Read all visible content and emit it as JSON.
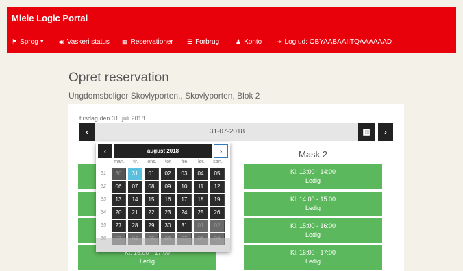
{
  "app": {
    "brand": "Miele Logic Portal"
  },
  "nav": {
    "items": [
      {
        "id": "sprog",
        "icon": "flag-icon",
        "label": "Sprog"
      },
      {
        "id": "vaskeri",
        "icon": "eye-icon",
        "label": "Vaskeri status"
      },
      {
        "id": "reservationer",
        "icon": "calendar-icon",
        "label": "Reservationer"
      },
      {
        "id": "forbrug",
        "icon": "list-icon",
        "label": "Forbrug"
      },
      {
        "id": "konto",
        "icon": "user-icon",
        "label": "Konto"
      },
      {
        "id": "logud",
        "icon": "logout-icon",
        "label": "Log ud: OBYAABAAIITQAAAAAAD"
      }
    ]
  },
  "page": {
    "title": "Opret reservation",
    "subtitle": "Ungdomsboliger Skovlyporten., Skovlyporten, Blok 2"
  },
  "date_selector": {
    "label": "tirsdag den 31. juli 2018",
    "value": "31-07-2018"
  },
  "machines": [
    {
      "name": "Mask 2"
    }
  ],
  "slots_left_partial": [
    "Kl. 16:00 - 17:00",
    "Ledig"
  ],
  "slots_mask2": [
    {
      "time": "Kl. 13:00 - 14:00",
      "status": "Ledig"
    },
    {
      "time": "Kl. 14:00 - 15:00",
      "status": "Ledig"
    },
    {
      "time": "Kl. 15:00 - 16:00",
      "status": "Ledig"
    },
    {
      "time": "Kl. 16:00 - 17:00",
      "status": "Ledig"
    }
  ],
  "datepicker": {
    "month_label": "august 2018",
    "weekdays": [
      "man.",
      "tir.",
      "ons.",
      "tor.",
      "fre.",
      "lør.",
      "søn."
    ],
    "weeks": [
      {
        "wk": "31",
        "days": [
          "30",
          "31",
          "01",
          "02",
          "03",
          "04",
          "05"
        ]
      },
      {
        "wk": "32",
        "days": [
          "06",
          "07",
          "08",
          "09",
          "10",
          "11",
          "12"
        ]
      },
      {
        "wk": "33",
        "days": [
          "13",
          "14",
          "15",
          "16",
          "17",
          "18",
          "19"
        ]
      },
      {
        "wk": "34",
        "days": [
          "20",
          "21",
          "22",
          "23",
          "24",
          "25",
          "26"
        ]
      },
      {
        "wk": "35",
        "days": [
          "27",
          "28",
          "29",
          "30",
          "31",
          "01",
          "02"
        ]
      },
      {
        "wk": "36",
        "days": [
          "03",
          "04",
          "05",
          "06",
          "07",
          "08",
          "09"
        ]
      }
    ]
  },
  "colors": {
    "navbar": "#e8000b",
    "slot": "#5cb85c",
    "today": "#5bc0de"
  }
}
